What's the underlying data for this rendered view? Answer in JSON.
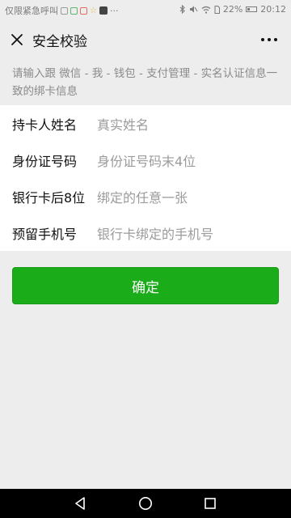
{
  "statusbar": {
    "left_text": "仅限紧急呼叫",
    "more": "···",
    "battery": "22%",
    "time": "20:12"
  },
  "header": {
    "title": "安全校验"
  },
  "tip": "请输入跟 微信 - 我 - 钱包 - 支付管理 - 实名认证信息一致的绑卡信息",
  "form": {
    "rows": [
      {
        "label": "持卡人姓名",
        "placeholder": "真实姓名"
      },
      {
        "label": "身份证号码",
        "placeholder": "身份证号码末4位"
      },
      {
        "label": "银行卡后8位",
        "placeholder": "绑定的任意一张"
      },
      {
        "label": "预留手机号",
        "placeholder": "银行卡绑定的手机号"
      }
    ]
  },
  "confirm_label": "确定",
  "colors": {
    "primary": "#1aad19",
    "background": "#ededed"
  }
}
